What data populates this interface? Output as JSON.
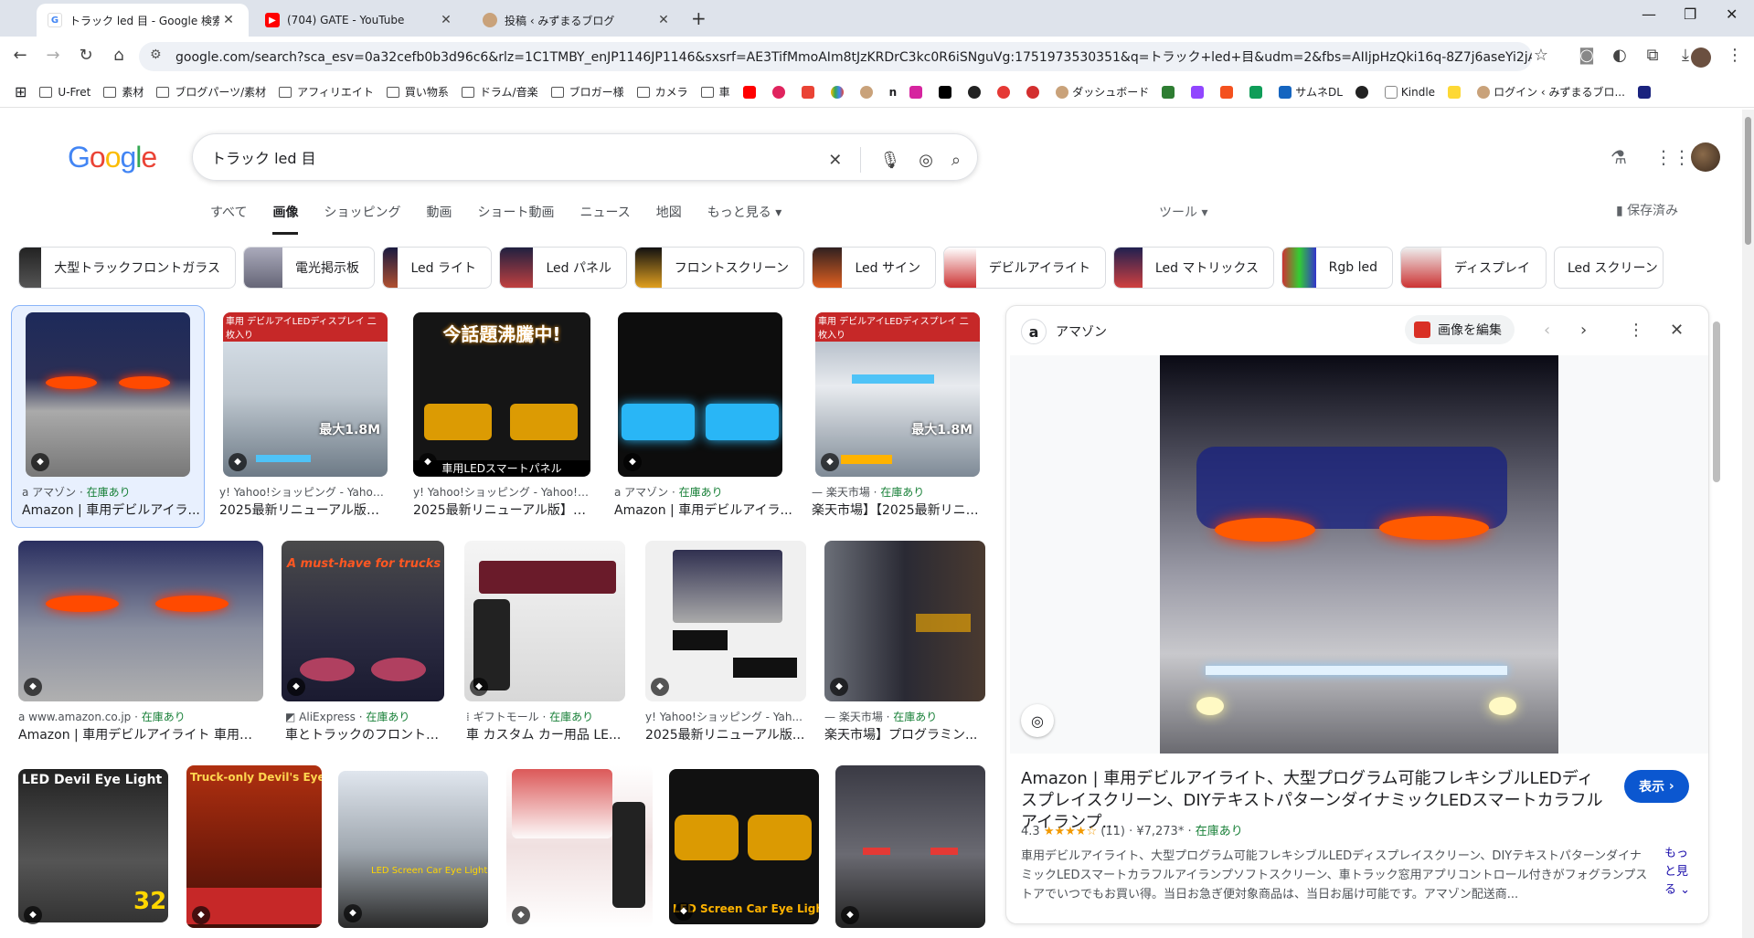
{
  "browser": {
    "tabs": [
      {
        "title": "トラック led 目 - Google 検索",
        "icon": "google-icon"
      },
      {
        "title": "(704) GATE - YouTube",
        "icon": "youtube-icon"
      },
      {
        "title": "投稿 ‹ みずまるブログ",
        "icon": "blog-icon"
      }
    ],
    "url": "google.com/search?sca_esv=0a32cefb0b3d96c6&rlz=1C1TMBY_enJP1146JP1146&sxsrf=AE3TifMmoAIm8tJzKRDrC3kc0R6iSNguVg:1751973530351&q=トラック+led+目&udm=2&fbs=AIIjpHzQki16q-8Z7j6aseYi2jA_awT46aeCpCIps-CmKmR...",
    "bookmarks": [
      "U-Fret",
      "素材",
      "ブログパーツ/素材",
      "アフィリエイト",
      "買い物系",
      "ドラム/音楽",
      "ブロガー様",
      "カメラ",
      "車",
      "ダッシュボード",
      "サムネDL",
      "Kindle",
      "ログイン ‹ みずまるブロ..."
    ]
  },
  "search": {
    "query": "トラック led 目",
    "tabs": [
      "すべて",
      "画像",
      "ショッピング",
      "動画",
      "ショート動画",
      "ニュース",
      "地図",
      "もっと見る"
    ],
    "active_tab": "画像",
    "tools_label": "ツール",
    "saved_label": "保存済み",
    "chips": [
      "大型トラックフロントガラス",
      "電光掲示板",
      "Led ライト",
      "Led パネル",
      "フロントスクリーン",
      "Led サイン",
      "デビルアイライト",
      "Led マトリックス",
      "Rgb led",
      "ディスプレイ",
      "Led スクリーン"
    ]
  },
  "results": [
    {
      "source": "アマゾン",
      "stock": "在庫あり",
      "caption": "Amazon | 車用デビルアイラ..."
    },
    {
      "source": "Yahoo!ショッピング - Yahoo! ...",
      "stock": "",
      "caption": "2025最新リニューアル版】デ..."
    },
    {
      "source": "Yahoo!ショッピング - Yahoo! ...",
      "stock": "",
      "caption": "2025最新リニューアル版】デ..."
    },
    {
      "source": "アマゾン",
      "stock": "在庫あり",
      "caption": "Amazon | 車用デビルアイラ..."
    },
    {
      "source": "楽天市場",
      "stock": "在庫あり",
      "caption": "楽天市場】【2025最新リニュ..."
    },
    {
      "source": "www.amazon.co.jp",
      "stock": "在庫あり",
      "caption": "Amazon | 車用デビルアイライト 車用悪..."
    },
    {
      "source": "AliExpress",
      "stock": "在庫あり",
      "caption": "車とトラックのフロントガ..."
    },
    {
      "source": "ギフトモール",
      "stock": "在庫あり",
      "caption": "車 カスタム カー用品 LE..."
    },
    {
      "source": "Yahoo!ショッピング - Yah...",
      "stock": "",
      "caption": "2025最新リニューアル版..."
    },
    {
      "source": "楽天市場",
      "stock": "在庫あり",
      "caption": "楽天市場】プログラミン..."
    }
  ],
  "image_text": {
    "r1": "車用 デビルアイLEDディスプレイ 二枚入り",
    "r1b": "最大1.8M",
    "r2": "今話題沸騰中!",
    "r2b": "車用LEDスマートパネル",
    "r3": "A must-have for trucks",
    "r4": "LED Devil Eye Light",
    "r4b": "32",
    "r5": "Truck-only Devil's Eye",
    "r6": "LED Screen Car Eye Light",
    "r7": "LED Screen Car Eye Light"
  },
  "panel": {
    "source": "アマゾン",
    "edit_label": "画像を編集",
    "title": "Amazon | 車用デビルアイライト、大型プログラム可能フレキシブルLEDディスプレイスクリーン、DIYテキストパターンダイナミックLEDスマートカラフルアイランプ...",
    "visit_label": "表示",
    "rating": "4.3",
    "stars": "★★★★☆",
    "reviews": "(11)",
    "price": "¥7,273*",
    "stock": "在庫あり",
    "description": "車用デビルアイライト、大型プログラム可能フレキシブルLEDディスプレイスクリーン、DIYテキストパターンダイナミックLEDスマートカラフルアイランプソフトスクリーン、車トラック窓用アプリコントロール付きがフォグランプストアでいつでもお買い得。当日お急ぎ便対象商品は、当日お届け可能です。アマゾン配送商...",
    "more_label": "もっと見る"
  },
  "colors": {
    "accent": "#0b57d0",
    "stock_green": "#188038",
    "chrome": "#dee3eb"
  }
}
